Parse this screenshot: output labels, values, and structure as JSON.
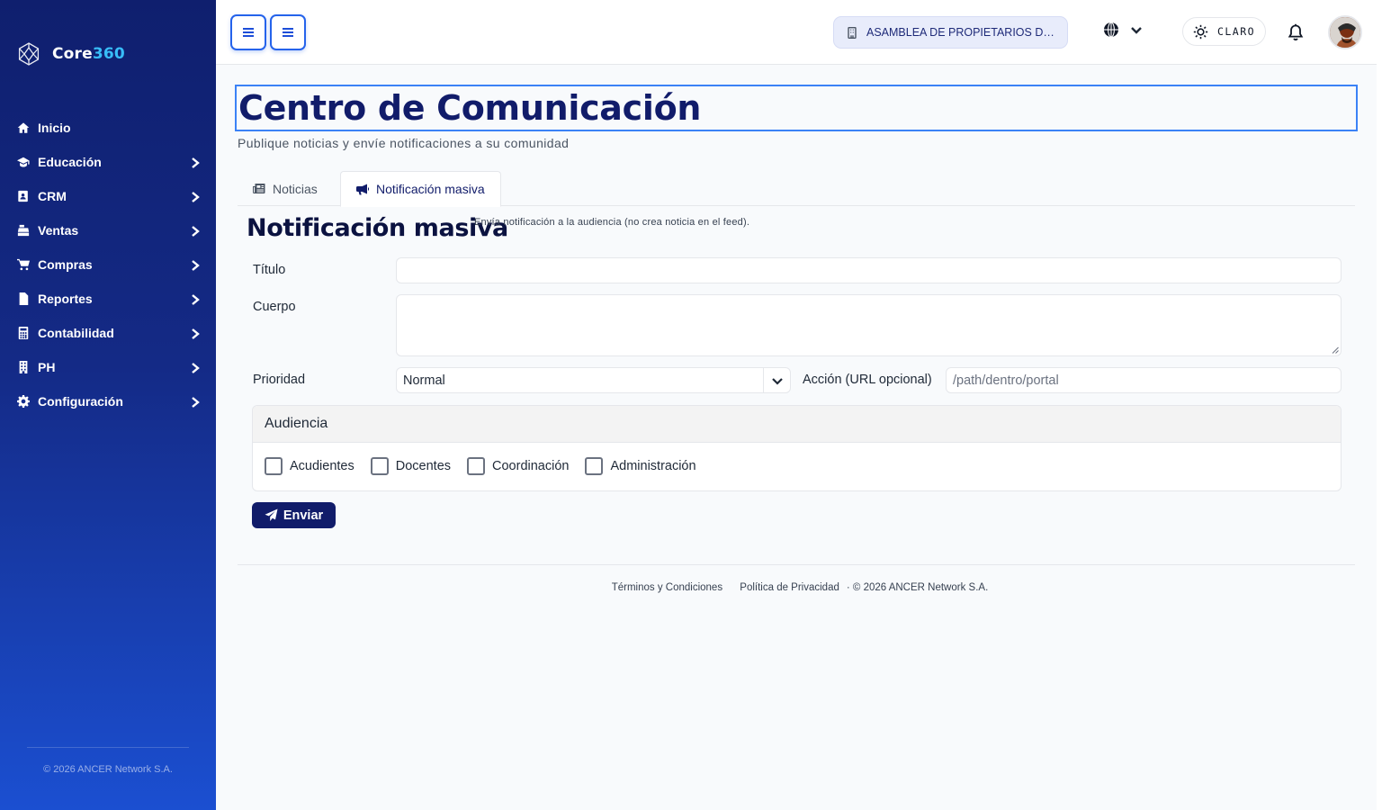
{
  "brand": {
    "name_part1": "Core",
    "name_part2": "360"
  },
  "sidebar": {
    "items": [
      {
        "label": "Inicio",
        "icon": "home-icon",
        "has_children": false
      },
      {
        "label": "Educación",
        "icon": "graduation-cap-icon",
        "has_children": true
      },
      {
        "label": "CRM",
        "icon": "address-book-icon",
        "has_children": true
      },
      {
        "label": "Ventas",
        "icon": "cash-register-icon",
        "has_children": true
      },
      {
        "label": "Compras",
        "icon": "shopping-cart-icon",
        "has_children": true
      },
      {
        "label": "Reportes",
        "icon": "file-icon",
        "has_children": true
      },
      {
        "label": "Contabilidad",
        "icon": "calculator-icon",
        "has_children": true
      },
      {
        "label": "PH",
        "icon": "building-icon",
        "has_children": true
      },
      {
        "label": "Configuración",
        "icon": "gear-icon",
        "has_children": true
      }
    ],
    "footer": "© 2026 ANCER Network S.A."
  },
  "topbar": {
    "organization": "ASAMBLEA DE PROPIETARIOS DE ...",
    "theme_label": "CLARO"
  },
  "page": {
    "title": "Centro de Comunicación",
    "subtitle": "Publique noticias y envíe notificaciones a su comunidad"
  },
  "tabs": [
    {
      "label": "Noticias",
      "icon": "newspaper-icon",
      "active": false
    },
    {
      "label": "Notificación masiva",
      "icon": "bullhorn-icon",
      "active": true
    }
  ],
  "form": {
    "section_title": "Notificación masiva",
    "section_description": "Envía notificación a la audiencia (no crea noticia en el feed).",
    "title_label": "Título",
    "title_value": "",
    "body_label": "Cuerpo",
    "body_value": "",
    "priority_label": "Prioridad",
    "priority_value": "Normal",
    "action_label": "Acción (URL opcional)",
    "action_placeholder": "/path/dentro/portal",
    "audience_title": "Audiencia",
    "audience_options": [
      {
        "label": "Acudientes",
        "checked": false
      },
      {
        "label": "Docentes",
        "checked": false
      },
      {
        "label": "Coordinación",
        "checked": false
      },
      {
        "label": "Administración",
        "checked": false
      }
    ],
    "submit_label": "Enviar"
  },
  "footer": {
    "terms": "Términos y Condiciones",
    "privacy": "Política de Privacidad",
    "copyright": "· © 2026 ANCER Network S.A."
  },
  "colors": {
    "sidebar_top": "#0f1f6e",
    "sidebar_bottom": "#1b4fd1",
    "primary": "#111c6a",
    "accent": "#38bdf8",
    "focus_border": "#3b82f6"
  }
}
